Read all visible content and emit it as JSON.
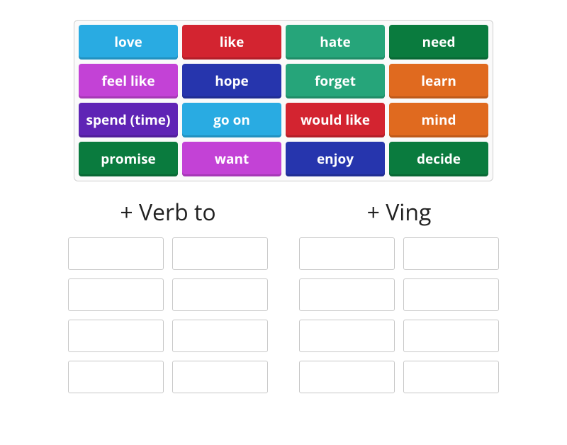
{
  "tiles": [
    {
      "label": "love",
      "color": "c-lightblue"
    },
    {
      "label": "like",
      "color": "c-red"
    },
    {
      "label": "hate",
      "color": "c-teal"
    },
    {
      "label": "need",
      "color": "c-green"
    },
    {
      "label": "feel like",
      "color": "c-magenta"
    },
    {
      "label": "hope",
      "color": "c-blue"
    },
    {
      "label": "forget",
      "color": "c-teal"
    },
    {
      "label": "learn",
      "color": "c-orange"
    },
    {
      "label": "spend (time)",
      "color": "c-purple"
    },
    {
      "label": "go on",
      "color": "c-lightblue"
    },
    {
      "label": "would like",
      "color": "c-red"
    },
    {
      "label": "mind",
      "color": "c-orange"
    },
    {
      "label": "promise",
      "color": "c-green"
    },
    {
      "label": "want",
      "color": "c-magenta"
    },
    {
      "label": "enjoy",
      "color": "c-blue"
    },
    {
      "label": "decide",
      "color": "c-green"
    }
  ],
  "categories": {
    "left": {
      "title": "+ Verb to",
      "slot_count": 8
    },
    "right": {
      "title": "+ Ving",
      "slot_count": 8
    }
  }
}
